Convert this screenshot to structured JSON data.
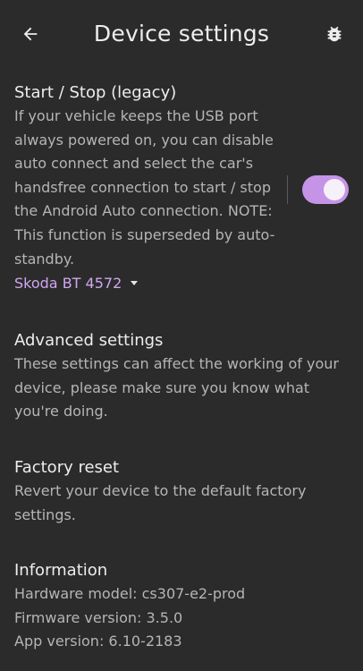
{
  "header": {
    "title": "Device settings",
    "back_icon": "arrow-left-icon",
    "debug_icon": "bug-icon"
  },
  "start_stop": {
    "title": "Start / Stop (legacy)",
    "description": "If your vehicle keeps the USB port always powered on, you can disable auto connect and select the car's handsfree connection to start / stop the Android Auto connection. NOTE: This function is superseded by auto-standby.",
    "selected_device": "Skoda BT 4572",
    "toggle_on": true
  },
  "advanced": {
    "title": "Advanced settings",
    "description": "These settings can affect the working of your device, please make sure you know what you're doing."
  },
  "factory_reset": {
    "title": "Factory reset",
    "description": "Revert your device to the default factory settings."
  },
  "information": {
    "title": "Information",
    "hardware_model": "Hardware model: cs307-e2-prod",
    "firmware_version": "Firmware version: 3.5.0",
    "app_version": "App version: 6.10-2183"
  },
  "colors": {
    "background": "#2b2b2b",
    "accent": "#c594e7",
    "link": "#cfa7f0"
  }
}
